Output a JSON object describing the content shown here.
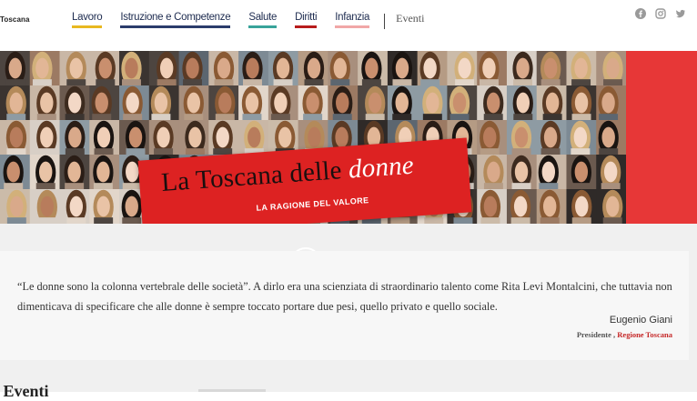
{
  "header": {
    "logo_text": "Toscana",
    "nav": [
      {
        "label": "Lavoro",
        "color": "#e8b820"
      },
      {
        "label": "Istruzione e Competenze",
        "color": "#2b3c6b"
      },
      {
        "label": "Salute",
        "color": "#38a39a"
      },
      {
        "label": "Diritti",
        "color": "#b71c1c"
      },
      {
        "label": "Infanzia",
        "color": "#f1a7a7"
      }
    ],
    "eventi_label": "Eventi",
    "social_icons": [
      "facebook-icon",
      "instagram-icon",
      "twitter-icon"
    ]
  },
  "hero": {
    "title_main": "La Toscana delle ",
    "title_em": "donne",
    "subtitle": "LA RAGIONE DEL VALORE",
    "accent_color": "#e73737"
  },
  "quote": {
    "text": "“Le donne sono la colonna vertebrale delle società”. A dirlo era una scienziata di straordinario talento come Rita Levi Montalcini, che tuttavia non dimenticava di specificare che alle donne è sempre toccato portare due pesi, quello privato e quello sociale.",
    "author": "Eugenio Giani",
    "role": "Presidente ,",
    "organization": "Regione Toscana"
  },
  "bottom": {
    "title_fragment": "l Eventi"
  }
}
